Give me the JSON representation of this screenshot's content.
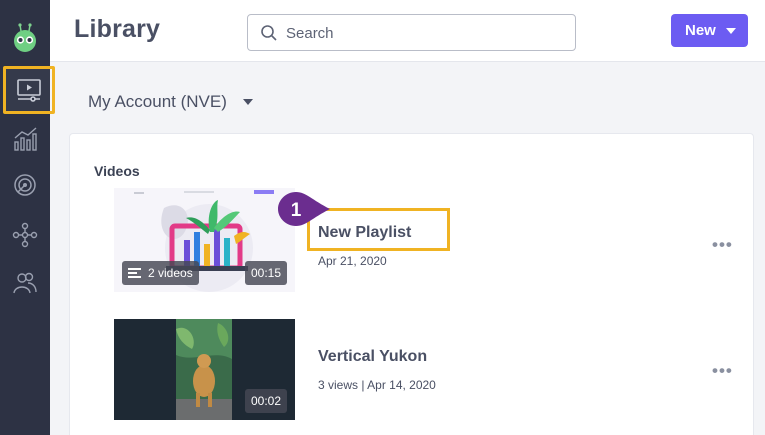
{
  "app": {
    "page_title": "Library",
    "search": {
      "placeholder": "Search",
      "value": ""
    },
    "new_button": "New"
  },
  "sidebar": {
    "items": [
      {
        "name": "library",
        "icon": "video-library-icon",
        "active": true
      },
      {
        "name": "analytics",
        "icon": "analytics-chart-icon"
      },
      {
        "name": "engagement",
        "icon": "target-icon"
      },
      {
        "name": "integrations",
        "icon": "network-icon"
      },
      {
        "name": "users",
        "icon": "users-icon"
      }
    ]
  },
  "account": {
    "label": "My Account (NVE)"
  },
  "videos": {
    "section_title": "Videos",
    "items": [
      {
        "title": "New Playlist",
        "meta": "Apr 21, 2020",
        "count_chip": "2 videos",
        "duration": "00:15",
        "type": "playlist"
      },
      {
        "title": "Vertical Yukon",
        "meta": "3 views  |  Apr 14, 2020",
        "duration": "00:02",
        "type": "video"
      }
    ],
    "more_label": "•••"
  },
  "callout": {
    "number": "1"
  },
  "colors": {
    "sidebar_bg": "#2d3244",
    "accent": "#6c5cf2",
    "highlight": "#f0b323",
    "callout": "#6b2d8f"
  }
}
